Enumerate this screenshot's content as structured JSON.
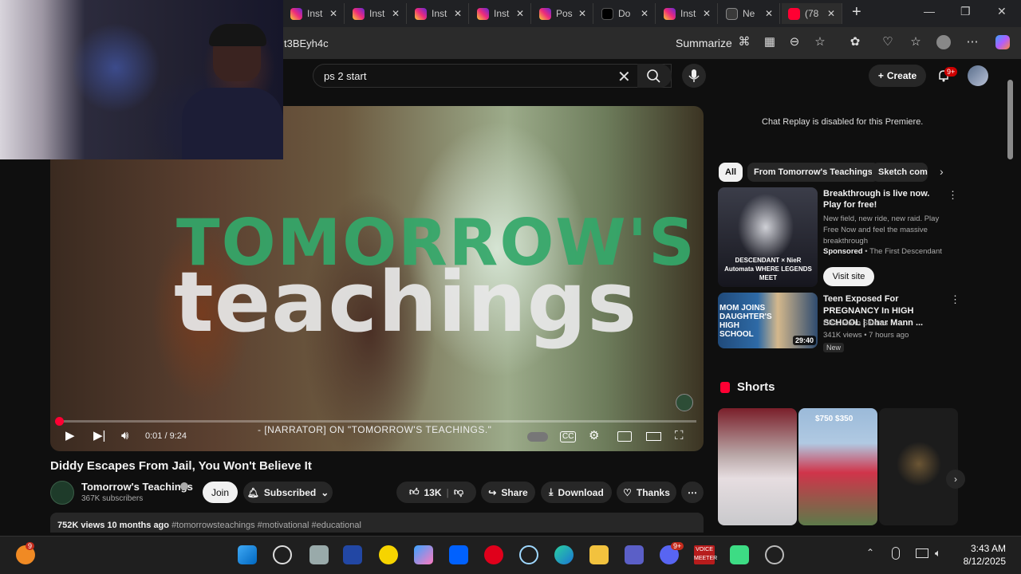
{
  "browser": {
    "tabs": [
      {
        "label": "Inst",
        "icon": "instagram-icon"
      },
      {
        "label": "Inst",
        "icon": "instagram-icon"
      },
      {
        "label": "Inst",
        "icon": "instagram-icon"
      },
      {
        "label": "Inst",
        "icon": "instagram-icon"
      },
      {
        "label": "Pos",
        "icon": "instagram-icon"
      },
      {
        "label": "Do",
        "icon": "tiktok-icon"
      },
      {
        "label": "Inst",
        "icon": "instagram-icon"
      },
      {
        "label": "Ne",
        "icon": "newtab-icon"
      },
      {
        "label": "(78",
        "icon": "youtube-icon"
      }
    ],
    "url_fragment": "t3BEyh4c",
    "summarize_label": "Summarize"
  },
  "youtube": {
    "search_query": "ps 2 start",
    "create_label": "Create",
    "notification_count": "9+",
    "video": {
      "watermark_line1": "TOMORROW'S",
      "watermark_line2": "teachings",
      "time": "0:01 / 9:24",
      "caption": "- [NARRATOR] ON \"TOMORROW'S TEACHINGS.\"",
      "progress": 0.002,
      "title": "Diddy Escapes From Jail, You Won't Believe It"
    },
    "channel": {
      "name": "Tomorrow's Teachings",
      "subscribers": "367K subscribers",
      "join_label": "Join",
      "subscribed_label": "Subscribed"
    },
    "actions": {
      "likes": "13K",
      "share": "Share",
      "download": "Download",
      "thanks": "Thanks"
    },
    "description": {
      "meta": "752K views  10 months ago",
      "tags": "#tomorrowsteachings #motivational #educational"
    },
    "sidebar": {
      "chat_message": "Chat Replay is disabled for this Premiere.",
      "chips": [
        "All",
        "From Tomorrow's Teachings",
        "Sketch come"
      ],
      "ad": {
        "thumb_text": "DESCENDANT × NieR Automata WHERE LEGENDS MEET",
        "title": "Breakthrough is live now. Play for free!",
        "description": "New field, new ride, new raid. Play Free Now and feel the massive breakthrough",
        "sponsor_label": "Sponsored",
        "sponsor_name": "The First Descendant",
        "visit_label": "Visit site"
      },
      "video": {
        "thumb_text": "MOM JOINS DAUGHTER'S HIGH SCHOOL",
        "duration": "29:40",
        "title": "Teen Exposed For PREGNANCY In HIGH SCHOOL | Dhar Mann ...",
        "channel": "Dhar Mann Studios",
        "meta": "341K views • 7 hours ago",
        "badge": "New"
      },
      "shorts_title": "Shorts",
      "short_prices": "$750   $350"
    }
  },
  "taskbar": {
    "time": "3:43 AM",
    "date": "8/12/2025",
    "weather_badge": "9",
    "discord_badge": "9+",
    "voicemeeter_label": "VOICE MEETER"
  },
  "colors": {
    "youtube_red": "#ff0033",
    "instagram": "#ee2a7b",
    "chip_active": "#f1f1f1"
  }
}
